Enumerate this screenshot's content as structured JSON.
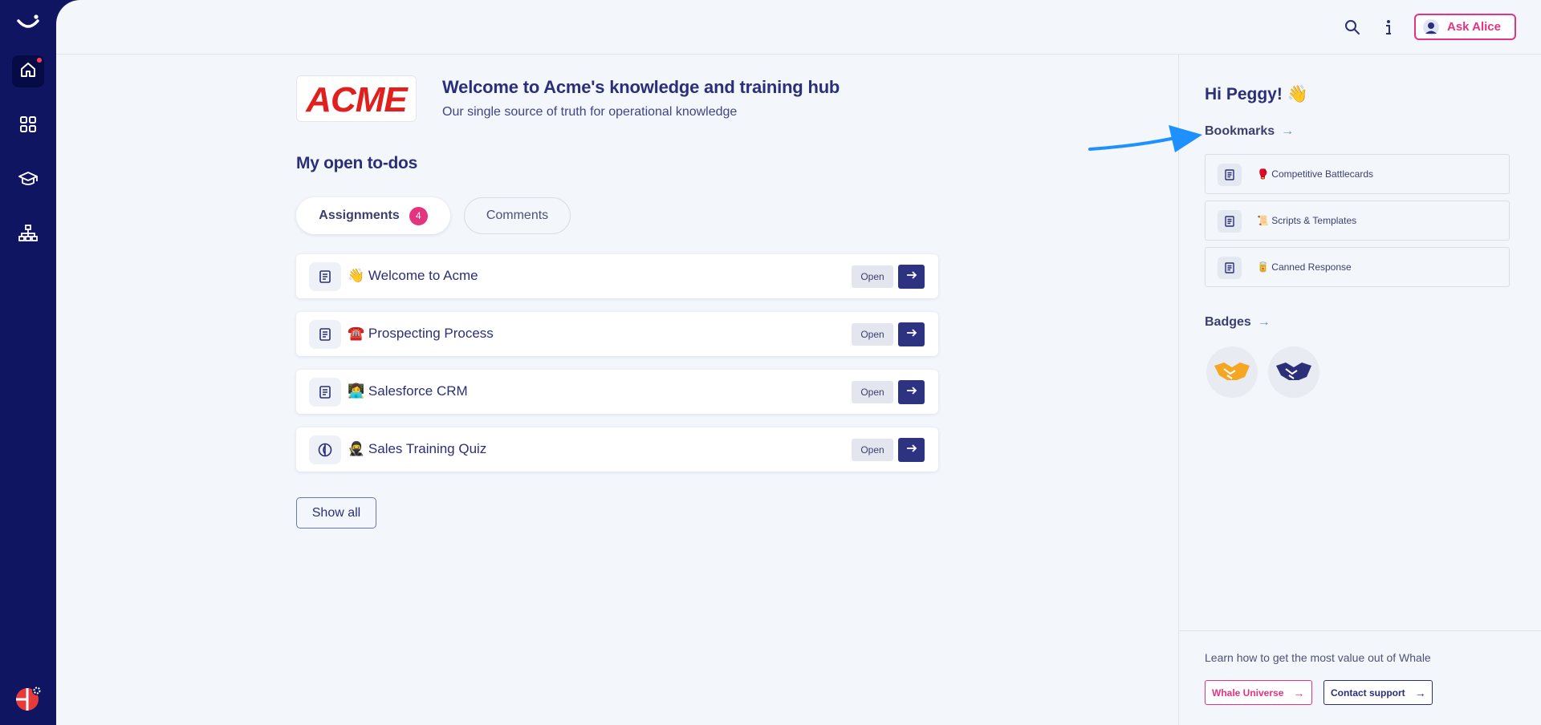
{
  "header": {
    "ask_label": "Ask Alice",
    "search_icon": "search-icon",
    "info_icon": "info-icon"
  },
  "sidebar": {
    "items": [
      {
        "name": "home",
        "icon": "home-icon",
        "active": true,
        "notification": true
      },
      {
        "name": "apps",
        "icon": "grid-icon",
        "active": false
      },
      {
        "name": "learning",
        "icon": "graduation-cap-icon",
        "active": false
      },
      {
        "name": "org-chart",
        "icon": "org-chart-icon",
        "active": false
      }
    ]
  },
  "hero": {
    "logo_text": "ACME",
    "title": "Welcome to Acme's knowledge and training hub",
    "subtitle": "Our single source of truth for operational knowledge"
  },
  "todos": {
    "title": "My open to-dos",
    "tabs": [
      {
        "label": "Assignments",
        "count": "4",
        "active": true
      },
      {
        "label": "Comments",
        "active": false
      }
    ],
    "items": [
      {
        "emoji": "👋",
        "label": "Welcome to Acme",
        "icon": "document-icon",
        "open_label": "Open"
      },
      {
        "emoji": "☎️",
        "label": "Prospecting Process",
        "icon": "document-icon",
        "open_label": "Open"
      },
      {
        "emoji": "👩‍💻",
        "label": "Salesforce CRM",
        "icon": "document-icon",
        "open_label": "Open"
      },
      {
        "emoji": "🥷",
        "label": "Sales Training Quiz",
        "icon": "quiz-icon",
        "open_label": "Open"
      }
    ],
    "show_all_label": "Show all"
  },
  "right_panel": {
    "greeting": "Hi Peggy! 👋",
    "bookmarks_title": "Bookmarks",
    "bookmarks": [
      {
        "emoji": "🥊",
        "label": "Competitive Battlecards"
      },
      {
        "emoji": "📜",
        "label": "Scripts & Templates"
      },
      {
        "emoji": "🥫",
        "label": "Canned Response"
      }
    ],
    "badges_title": "Badges",
    "badges": [
      {
        "icon": "handshake-icon",
        "color": "#f5a623"
      },
      {
        "icon": "handshake-icon",
        "color": "#2b2f77"
      }
    ],
    "footer_text": "Learn how to get the most value out of Whale",
    "whale_universe_label": "Whale Universe",
    "contact_support_label": "Contact support"
  },
  "colors": {
    "rail": "#0f1560",
    "accent_pink": "#e5337f",
    "primary_navy": "#2d3380",
    "annotation_arrow": "#1e90ff"
  }
}
